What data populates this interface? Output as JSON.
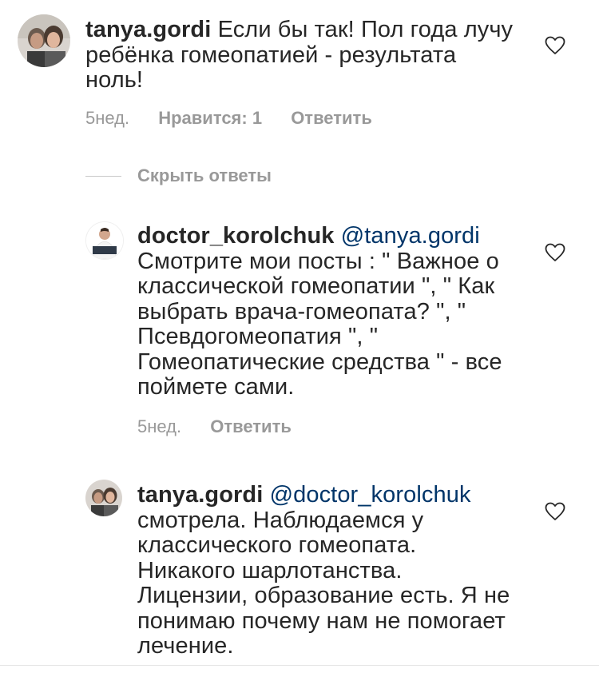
{
  "comments": [
    {
      "username": "tanya.gordi",
      "mention": "",
      "text": "Если бы так! Пол года лучу ребёнка гомеопатией - результата ноль!",
      "time": "5нед.",
      "likes": "Нравится: 1",
      "reply": "Ответить"
    },
    {
      "username": "doctor_korolchuk",
      "mention": "@tanya.gordi",
      "text": "Смотрите мои посты : \" Важное о классической гомеопатии \", \" Как выбрать врача-гомеопата? \", \" Псевдогомеопатия \", \" Гомеопатические средства \" - все поймете сами.",
      "time": "5нед.",
      "reply": "Ответить"
    },
    {
      "username": "tanya.gordi",
      "mention": "@doctor_korolchuk",
      "text": "смотрела. Наблюдаемся у классического гомеопата. Никакого шарлотанства. Лицензии, образование есть. Я не понимаю почему нам не помогает лечение.",
      "time": "",
      "reply": ""
    }
  ],
  "replies_toggle": "Скрыть ответы",
  "icons": {
    "like": "heart-outline-icon",
    "avatar_user": "user-photo-avatar",
    "avatar_doctor": "doctor-photo-avatar"
  },
  "colors": {
    "text": "#262626",
    "muted": "#999999",
    "mention": "#003569",
    "divider": "#c7c7c7"
  }
}
